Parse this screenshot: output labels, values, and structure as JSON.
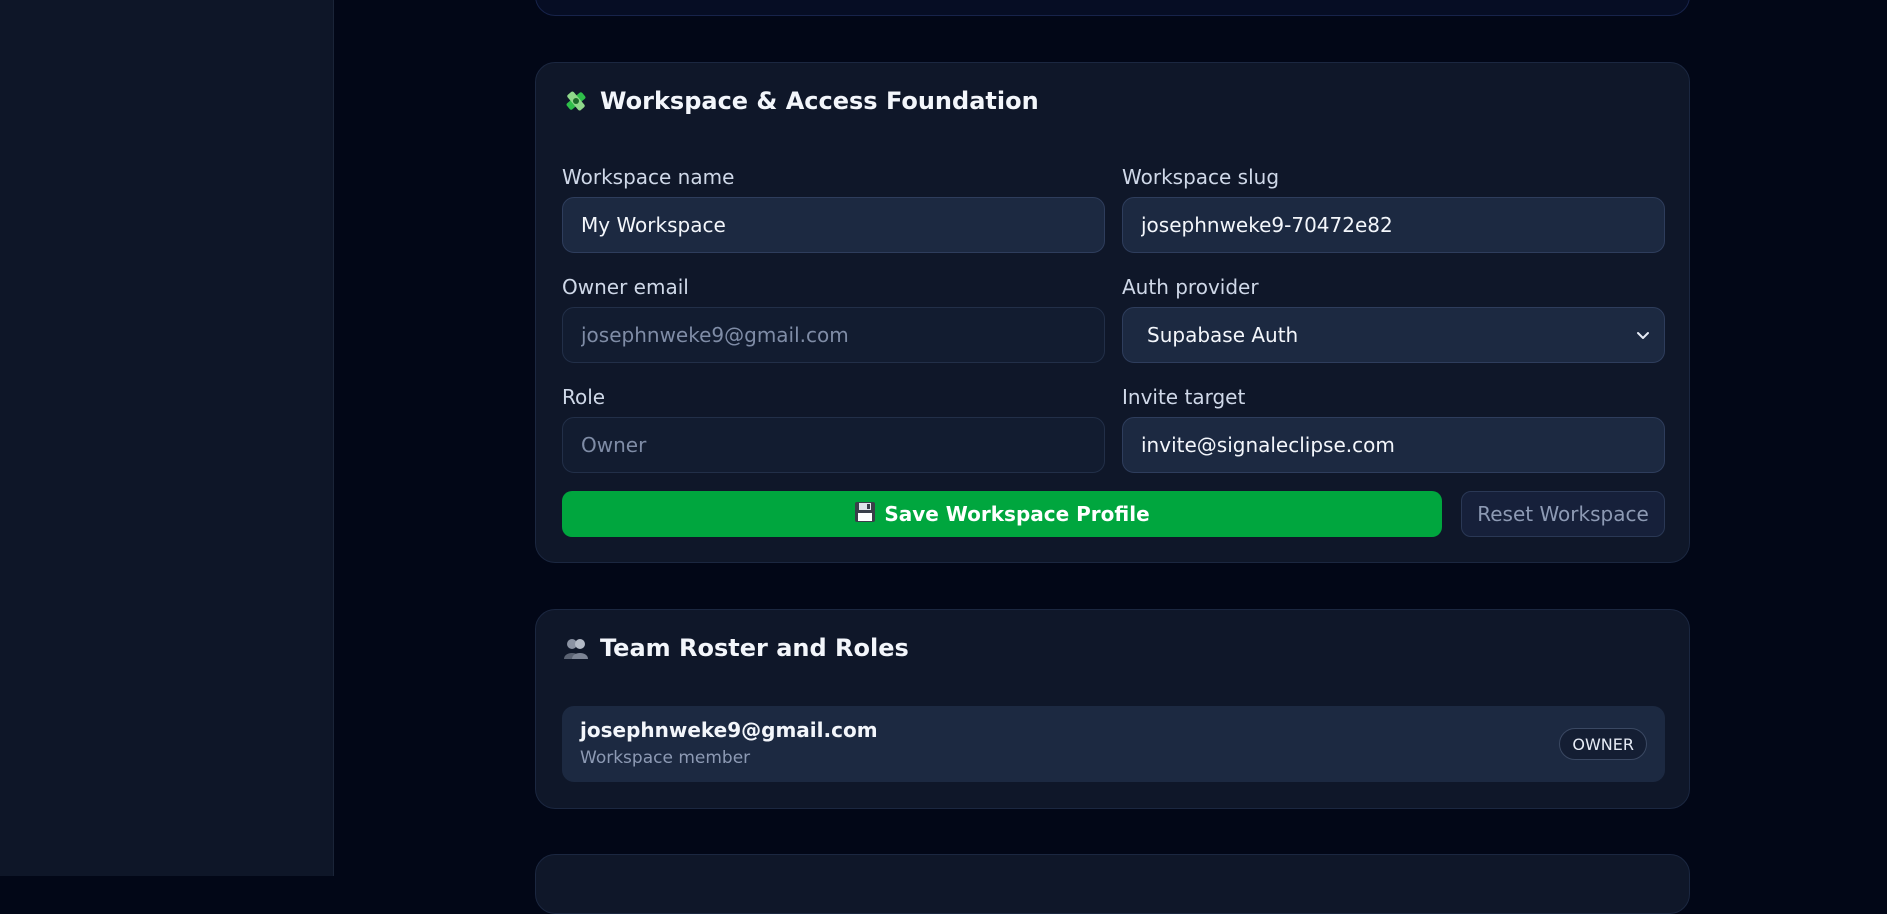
{
  "workspace_card": {
    "title": "Workspace & Access Foundation",
    "title_icon": "puzzle-piece-icon",
    "fields": {
      "workspace_name": {
        "label": "Workspace name",
        "value": "My Workspace"
      },
      "workspace_slug": {
        "label": "Workspace slug",
        "value": "josephnweke9-70472e82"
      },
      "owner_email": {
        "label": "Owner email",
        "value": "josephnweke9@gmail.com"
      },
      "auth_provider": {
        "label": "Auth provider",
        "value": "Supabase Auth"
      },
      "role": {
        "label": "Role",
        "value": "Owner"
      },
      "invite_target": {
        "label": "Invite target",
        "value": "invite@signaleclipse.com"
      }
    },
    "save_button": {
      "label": "Save Workspace Profile",
      "icon": "floppy-disk-icon"
    },
    "reset_button": {
      "label": "Reset Workspace"
    }
  },
  "team_card": {
    "title": "Team Roster and Roles",
    "title_icon": "people-icon",
    "members": [
      {
        "email": "josephnweke9@gmail.com",
        "subtitle": "Workspace member",
        "role": "OWNER"
      }
    ]
  },
  "colors": {
    "background": "#020717",
    "sidebar": "#0e1628",
    "card": "#0f1729",
    "input": "#1c2941",
    "accent_green": "#00a63e"
  }
}
